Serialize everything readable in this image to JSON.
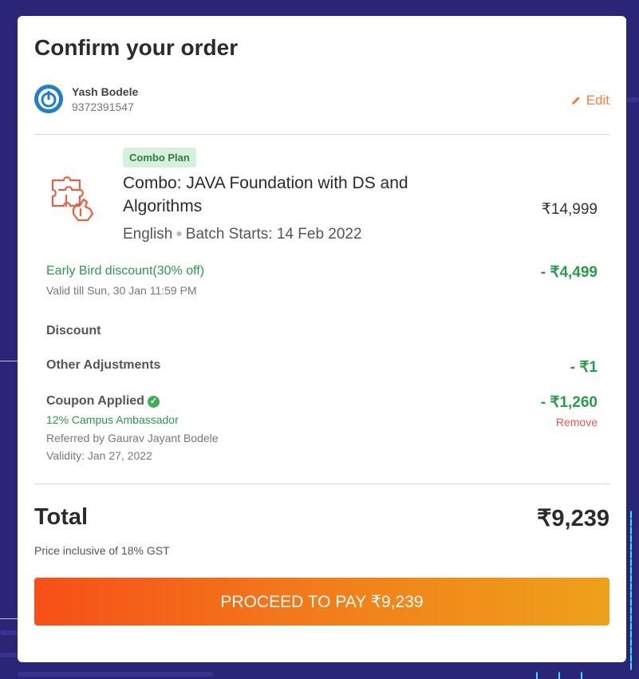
{
  "title": "Confirm your order",
  "user": {
    "name": "Yash Bodele",
    "phone": "9372391547",
    "edit_label": "Edit"
  },
  "course": {
    "badge": "Combo Plan",
    "name": "Combo: JAVA Foundation with DS and Algorithms",
    "language": "English",
    "batch_prefix": "Batch",
    "starts_label": "Starts:",
    "start_date": "14 Feb 2022",
    "price": "₹14,999"
  },
  "early_bird": {
    "label": "Early Bird discount(30% off)",
    "validity": "Valid till Sun, 30 Jan 11:59 PM",
    "amount": "- ₹4,499"
  },
  "discount": {
    "label": "Discount"
  },
  "adjustments": {
    "label": "Other Adjustments",
    "amount": "- ₹1"
  },
  "coupon": {
    "label": "Coupon Applied",
    "name": "12% Campus Ambassador",
    "referred_by": "Referred by Gaurav Jayant Bodele",
    "validity": "Validity: Jan 27, 2022",
    "amount": "- ₹1,260",
    "remove_label": "Remove"
  },
  "total": {
    "label": "Total",
    "amount": "₹9,239",
    "note": "Price inclusive of 18% GST"
  },
  "cta": {
    "label": "PROCEED TO PAY ₹9,239"
  },
  "colors": {
    "accent_orange": "#f0823c",
    "discount_green": "#2b9a4a",
    "remove_red": "#e8574c",
    "background": "#2a2577"
  }
}
